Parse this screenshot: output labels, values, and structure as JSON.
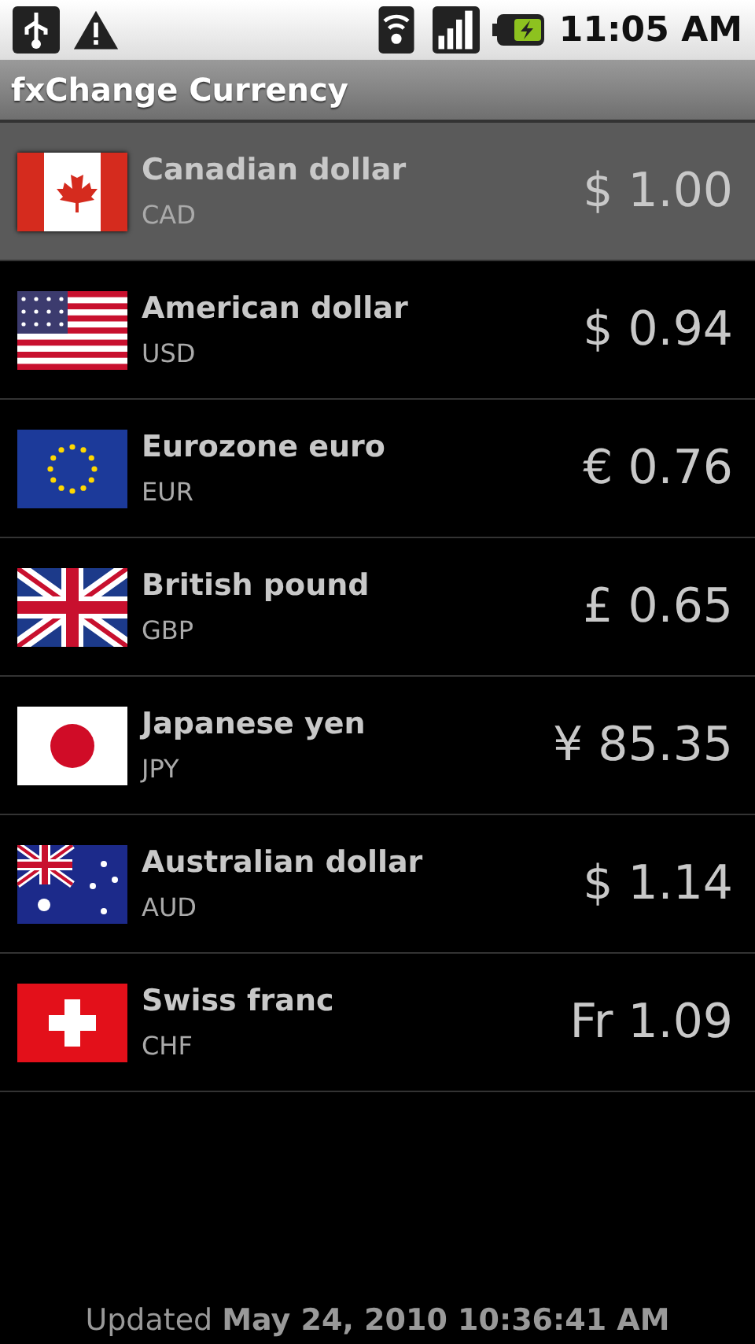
{
  "status_bar": {
    "time": "11:05 AM"
  },
  "title": "fxChange Currency",
  "currencies": [
    {
      "kind": "cad",
      "name": "Canadian dollar",
      "code": "CAD",
      "amount": "$ 1.00",
      "selected": true
    },
    {
      "kind": "usd",
      "name": "American dollar",
      "code": "USD",
      "amount": "$ 0.94",
      "selected": false
    },
    {
      "kind": "eur",
      "name": "Eurozone euro",
      "code": "EUR",
      "amount": "€ 0.76",
      "selected": false
    },
    {
      "kind": "gbp",
      "name": "British pound",
      "code": "GBP",
      "amount": "£ 0.65",
      "selected": false
    },
    {
      "kind": "jpy",
      "name": "Japanese yen",
      "code": "JPY",
      "amount": "¥ 85.35",
      "selected": false
    },
    {
      "kind": "aud",
      "name": "Australian dollar",
      "code": "AUD",
      "amount": "$ 1.14",
      "selected": false
    },
    {
      "kind": "chf",
      "name": "Swiss franc",
      "code": "CHF",
      "amount": "Fr 1.09",
      "selected": false
    }
  ],
  "footer": "Updated **May 24, 2010 10:36:41 AM**"
}
